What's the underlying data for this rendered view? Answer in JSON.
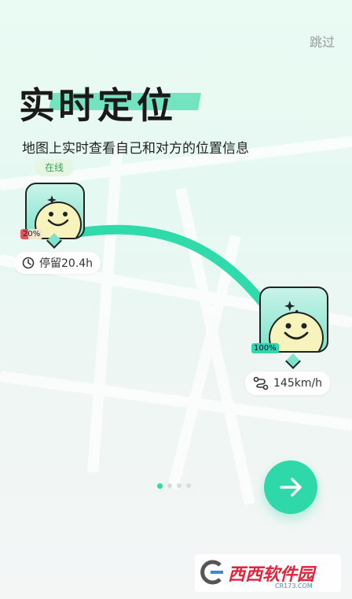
{
  "header": {
    "skip_label": "跳过"
  },
  "hero": {
    "title": "实时定位",
    "subtitle": "地图上实时查看自己和对方的位置信息"
  },
  "user_a": {
    "status": "在线",
    "battery": "20%",
    "stay_label": "停留20.4h"
  },
  "user_b": {
    "battery": "100%",
    "speed_label": "145km/h"
  },
  "pager": {
    "pages": 4,
    "active": 0
  },
  "watermark": {
    "brand": "西西软件园",
    "url": "CR173.COM"
  },
  "colors": {
    "accent": "#2fd8a8",
    "battery_low": "#e2555c",
    "battery_full": "#2fd8a8"
  }
}
